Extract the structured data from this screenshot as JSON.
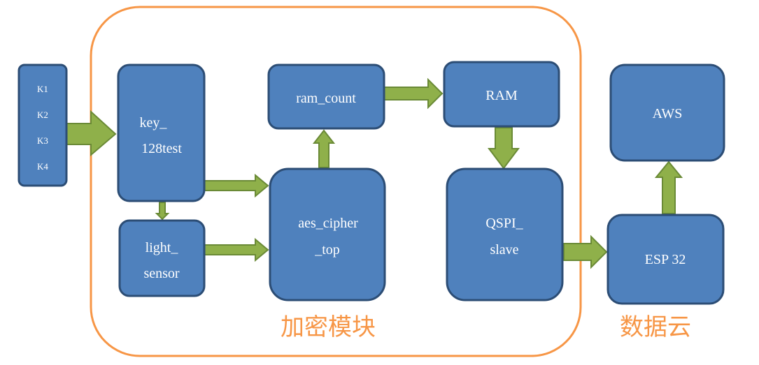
{
  "colors": {
    "block_fill": "#4f81bd",
    "block_stroke": "#2c4d75",
    "arrow_fill": "#8fb04a",
    "arrow_stroke": "#6a8a36",
    "group_stroke": "#f79646",
    "text": "#ffffff"
  },
  "keys": [
    "K1",
    "K2",
    "K3",
    "K4"
  ],
  "blocks": {
    "key_128test": [
      "key_",
      "128test"
    ],
    "light_sensor": [
      "light_",
      "sensor"
    ],
    "ram_count": [
      "ram_count"
    ],
    "aes_cipher_top": [
      "aes_cipher",
      "_top"
    ],
    "ram": [
      "RAM"
    ],
    "qspi_slave": [
      "QSPI_",
      "slave"
    ],
    "aws": [
      "AWS"
    ],
    "esp32": [
      "ESP 32"
    ]
  },
  "groups": {
    "encryption_module": "加密模块",
    "data_cloud": "数据云"
  }
}
